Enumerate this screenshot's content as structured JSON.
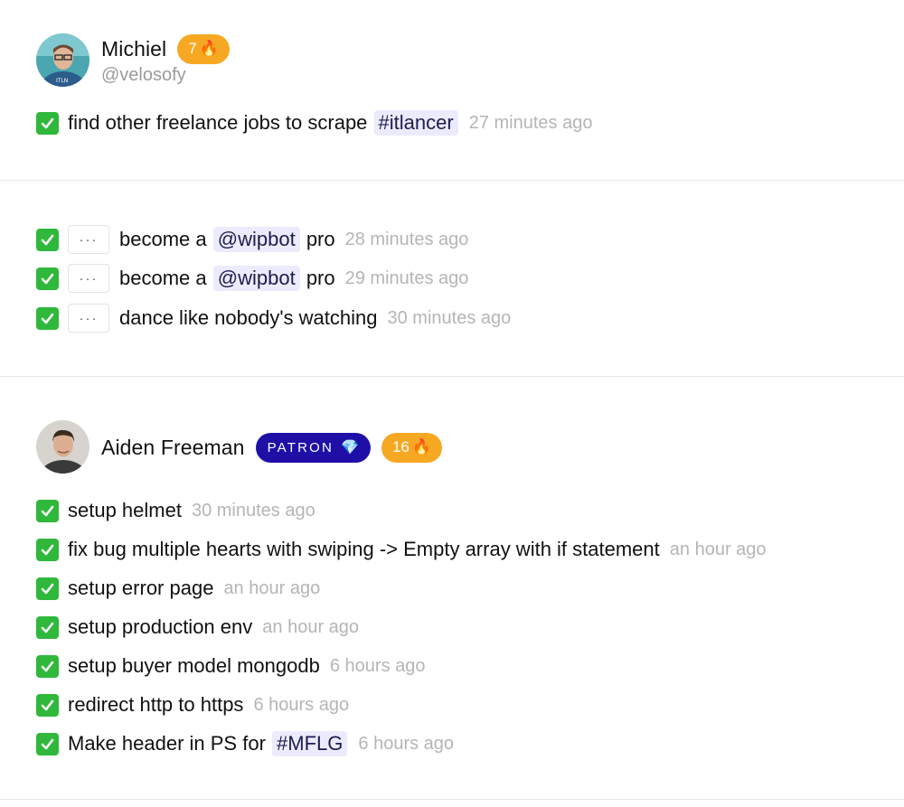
{
  "posts": [
    {
      "user": {
        "name": "Michiel",
        "handle": "@velosofy",
        "streak": "7",
        "streak_icon": "fire-icon",
        "avatar": "avatar-michiel"
      },
      "todos": [
        {
          "pre": "find other freelance jobs to scrape ",
          "tag": "#itlancer",
          "post": "",
          "time": "27 minutes ago"
        }
      ]
    },
    {
      "todos": [
        {
          "pre": "become a ",
          "tag": "@wipbot",
          "post": " pro",
          "time": "28 minutes ago",
          "more": "···"
        },
        {
          "pre": "become a ",
          "tag": "@wipbot",
          "post": " pro",
          "time": "29 minutes ago",
          "more": "···"
        },
        {
          "pre": "dance like nobody's watching",
          "tag": "",
          "post": "",
          "time": "30 minutes ago",
          "more": "···"
        }
      ]
    },
    {
      "user": {
        "name": "Aiden Freeman",
        "patron": "PATRON",
        "patron_icon": "gem-icon",
        "streak": "16",
        "streak_icon": "fire-icon",
        "avatar": "avatar-aiden"
      },
      "todos": [
        {
          "pre": "setup helmet",
          "tag": "",
          "post": "",
          "time": "30 minutes ago"
        },
        {
          "pre": "fix bug multiple hearts with swiping -> Empty array with if statement",
          "tag": "",
          "post": "",
          "time": "an hour ago"
        },
        {
          "pre": "setup error page",
          "tag": "",
          "post": "",
          "time": "an hour ago"
        },
        {
          "pre": "setup production env",
          "tag": "",
          "post": "",
          "time": "an hour ago"
        },
        {
          "pre": "setup buyer model mongodb",
          "tag": "",
          "post": "",
          "time": "6 hours ago"
        },
        {
          "pre": "redirect http to https",
          "tag": "",
          "post": "",
          "time": "6 hours ago"
        },
        {
          "pre": "Make header in PS for ",
          "tag": "#MFLG",
          "post": "",
          "time": "6 hours ago"
        }
      ]
    }
  ],
  "colors": {
    "check": "#2fb83b",
    "streak": "#f7a823",
    "patron": "#1f0fa6",
    "tag_bg": "#ecebfd",
    "time": "#b5b5b5"
  }
}
